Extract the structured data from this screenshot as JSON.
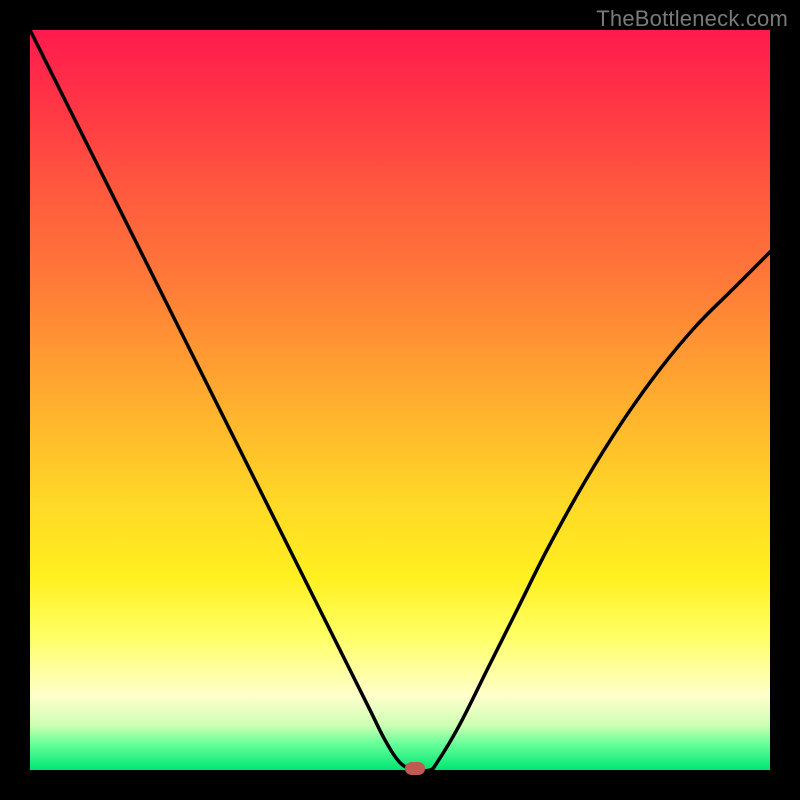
{
  "watermark": "TheBottleneck.com",
  "colors": {
    "frame": "#000000",
    "gradient_top": "#ff1a4d",
    "gradient_bottom": "#00e673",
    "curve": "#000000",
    "marker": "#c15a50"
  },
  "chart_data": {
    "type": "line",
    "title": "",
    "xlabel": "",
    "ylabel": "",
    "xlim": [
      0,
      100
    ],
    "ylim": [
      0,
      100
    ],
    "series": [
      {
        "name": "bottleneck-curve",
        "x": [
          0,
          5,
          10,
          15,
          20,
          25,
          30,
          35,
          40,
          43,
          46,
          48,
          50,
          52,
          54,
          55,
          58,
          62,
          66,
          70,
          75,
          80,
          85,
          90,
          95,
          100
        ],
        "values": [
          100,
          90,
          80,
          70,
          60,
          50,
          40,
          30,
          20,
          14,
          8,
          4,
          1,
          0,
          0,
          1,
          6,
          14,
          22,
          30,
          39,
          47,
          54,
          60,
          65,
          70
        ]
      }
    ],
    "marker": {
      "x": 52,
      "y": 0
    },
    "annotations": []
  }
}
